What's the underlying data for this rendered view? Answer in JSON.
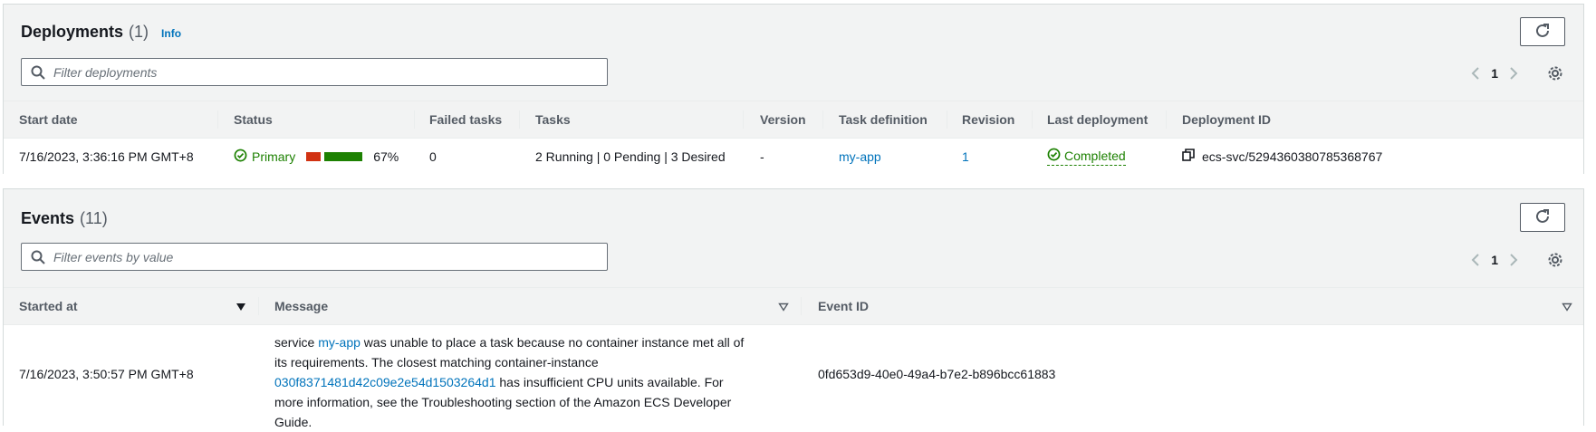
{
  "deployments": {
    "title": "Deployments",
    "count": "(1)",
    "info_label": "Info",
    "filter_placeholder": "Filter deployments",
    "page": "1",
    "columns": [
      "Start date",
      "Status",
      "Failed tasks",
      "Tasks",
      "Version",
      "Task definition",
      "Revision",
      "Last deployment",
      "Deployment ID"
    ],
    "rows": [
      {
        "start_date": "7/16/2023, 3:36:16 PM GMT+8",
        "status": "Primary",
        "progress_percent_label": "67%",
        "progress_fraction": 0.67,
        "failed_tasks": "0",
        "tasks": "2 Running | 0 Pending | 3 Desired",
        "version": "-",
        "task_definition": "my-app",
        "revision": "1",
        "last_deployment": "Completed",
        "deployment_id": "ecs-svc/5294360380785368767"
      }
    ]
  },
  "events": {
    "title": "Events",
    "count": "(11)",
    "filter_placeholder": "Filter events by value",
    "page": "1",
    "columns": [
      "Started at",
      "Message",
      "Event ID"
    ],
    "rows": [
      {
        "started_at": "7/16/2023, 3:50:57 PM GMT+8",
        "message_prefix": "service ",
        "message_service": "my-app",
        "message_mid": " was unable to place a task because no container instance met all of its requirements. The closest matching container-instance ",
        "message_instance": "030f8371481d42c09e2e54d1503264d1",
        "message_suffix": " has insufficient CPU units available. For more information, see the Troubleshooting section of the Amazon ECS Developer Guide.",
        "event_id": "0fd653d9-40e0-49a4-b7e2-b896bcc61883"
      }
    ]
  },
  "colors": {
    "accent_link": "#0073bb",
    "success": "#1d8102",
    "error": "#d13212",
    "header_bg": "#f2f3f3"
  },
  "icons": [
    "search-icon",
    "refresh-icon",
    "chevron-left-icon",
    "chevron-right-icon",
    "gear-icon",
    "check-circle-icon",
    "copy-icon",
    "sort-descending-icon",
    "sort-icon"
  ]
}
